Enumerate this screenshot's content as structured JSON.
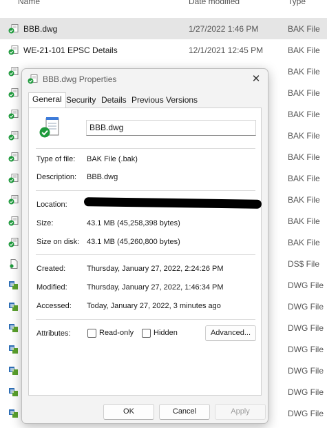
{
  "explorer": {
    "columns": {
      "name": "Name",
      "date": "Date modified",
      "type": "Type"
    },
    "rows": [
      {
        "name": "BBB.dwg",
        "date": "1/27/2022 1:46 PM",
        "type": "BAK File",
        "icon": "bak-file-icon",
        "selected": true
      },
      {
        "name": "WE-21-101 EPSC Details",
        "date": "12/1/2021 12:45 PM",
        "type": "BAK File",
        "icon": "bak-file-icon"
      },
      {
        "name": "",
        "date": "",
        "type": "BAK File",
        "icon": "bak-file-icon"
      },
      {
        "name": "",
        "date": "",
        "type": "BAK File",
        "icon": "bak-file-icon"
      },
      {
        "name": "",
        "date": "",
        "type": "BAK File",
        "icon": "bak-file-icon"
      },
      {
        "name": "",
        "date": "",
        "type": "BAK File",
        "icon": "bak-file-icon"
      },
      {
        "name": "",
        "date": "",
        "type": "BAK File",
        "icon": "bak-file-icon"
      },
      {
        "name": "",
        "date": "",
        "type": "BAK File",
        "icon": "bak-file-icon"
      },
      {
        "name": "",
        "date": "",
        "type": "BAK File",
        "icon": "bak-file-icon"
      },
      {
        "name": "",
        "date": "",
        "type": "BAK File",
        "icon": "bak-file-icon"
      },
      {
        "name": "",
        "date": "",
        "type": "BAK File",
        "icon": "bak-file-icon"
      },
      {
        "name": "",
        "date": "",
        "type": "DS$ File",
        "icon": "blank-file-icon"
      },
      {
        "name": "",
        "date": "",
        "type": "DWG File",
        "icon": "dwg-file-icon"
      },
      {
        "name": "",
        "date": "",
        "type": "DWG File",
        "icon": "dwg-file-icon"
      },
      {
        "name": "",
        "date": "",
        "type": "DWG File",
        "icon": "dwg-file-icon"
      },
      {
        "name": "",
        "date": "",
        "type": "DWG File",
        "icon": "dwg-file-icon"
      },
      {
        "name": "",
        "date": "",
        "type": "DWG File",
        "icon": "dwg-file-icon"
      },
      {
        "name": "",
        "date": "",
        "type": "DWG File",
        "icon": "dwg-file-icon"
      },
      {
        "name": "",
        "date": "",
        "type": "DWG File",
        "icon": "dwg-file-icon"
      }
    ]
  },
  "dialog": {
    "title": "BBB.dwg Properties",
    "close_glyph": "✕",
    "tabs": [
      {
        "label": "General",
        "active": true
      },
      {
        "label": "Security"
      },
      {
        "label": "Details"
      },
      {
        "label": "Previous Versions"
      }
    ],
    "file_name": "BBB.dwg",
    "type_label": "Type of file:",
    "type_value": "BAK File (.bak)",
    "description_label": "Description:",
    "description_value": "BBB.dwg",
    "location_label": "Location:",
    "size_label": "Size:",
    "size_value": "43.1 MB (45,258,398 bytes)",
    "size_on_disk_label": "Size on disk:",
    "size_on_disk_value": "43.1 MB (45,260,800 bytes)",
    "created_label": "Created:",
    "created_value": "Thursday, January 27, 2022, 2:24:26 PM",
    "modified_label": "Modified:",
    "modified_value": "Thursday, January 27, 2022, 1:46:34 PM",
    "accessed_label": "Accessed:",
    "accessed_value": "Today, January 27, 2022, 3 minutes ago",
    "attributes_label": "Attributes:",
    "readonly_label": "Read-only",
    "hidden_label": "Hidden",
    "advanced_label": "Advanced...",
    "ok_label": "OK",
    "cancel_label": "Cancel",
    "apply_label": "Apply"
  },
  "colors": {
    "selected_row": "#e5e5e5",
    "dialog_bg": "#f3f3f3",
    "panel_bg": "#ffffff",
    "bak_icon_green": "#1e9a3c",
    "dwg_icon_blue": "#2f6fb5"
  }
}
